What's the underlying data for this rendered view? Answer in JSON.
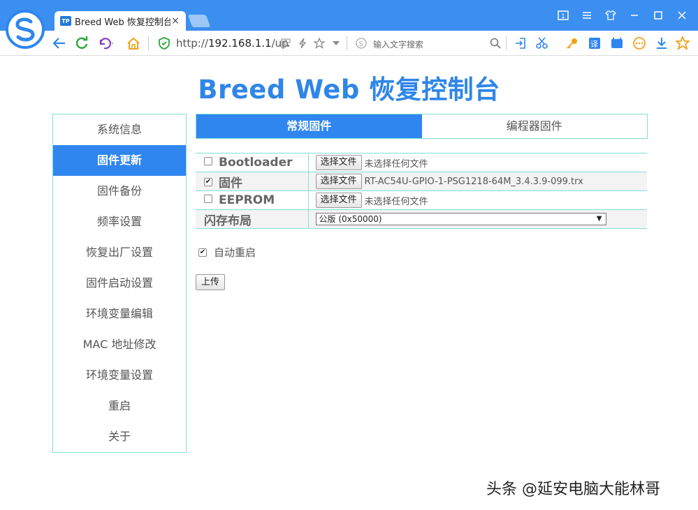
{
  "browser": {
    "tab_icon_text": "TP",
    "tab_title": "Breed Web 恢复控制台",
    "tab_close": "×",
    "address_prefix": "http://",
    "address_host": "192.168.1.1",
    "address_path": "/up",
    "search_placeholder": "输入文字搜索",
    "accent_color": "#3b8ff0"
  },
  "page": {
    "title": "Breed Web 恢复控制台"
  },
  "sidebar": {
    "items": [
      {
        "label": "系统信息"
      },
      {
        "label": "固件更新"
      },
      {
        "label": "固件备份"
      },
      {
        "label": "频率设置"
      },
      {
        "label": "恢复出厂设置"
      },
      {
        "label": "固件启动设置"
      },
      {
        "label": "环境变量编辑"
      },
      {
        "label": "MAC 地址修改"
      },
      {
        "label": "环境变量设置"
      },
      {
        "label": "重启"
      },
      {
        "label": "关于"
      }
    ],
    "active_index": 1
  },
  "firmware_tabs": [
    {
      "label": "常规固件"
    },
    {
      "label": "编程器固件"
    }
  ],
  "firmware_table": {
    "rows": [
      {
        "label": "Bootloader",
        "checked": false,
        "button": "选择文件",
        "file": "未选择任何文件"
      },
      {
        "label": "固件",
        "checked": true,
        "button": "选择文件",
        "file": "RT-AC54U-GPIO-1-PSG1218-64M_3.4.3.9-099.trx"
      },
      {
        "label": "EEPROM",
        "checked": false,
        "button": "选择文件",
        "file": "未选择任何文件"
      }
    ],
    "flash_layout": {
      "label": "闪存布局",
      "selected": "公版 (0x50000)"
    }
  },
  "auto_restart": {
    "label": "自动重启",
    "checked": true
  },
  "upload_button": "上传",
  "watermark": "头条 @延安电脑大能林哥"
}
